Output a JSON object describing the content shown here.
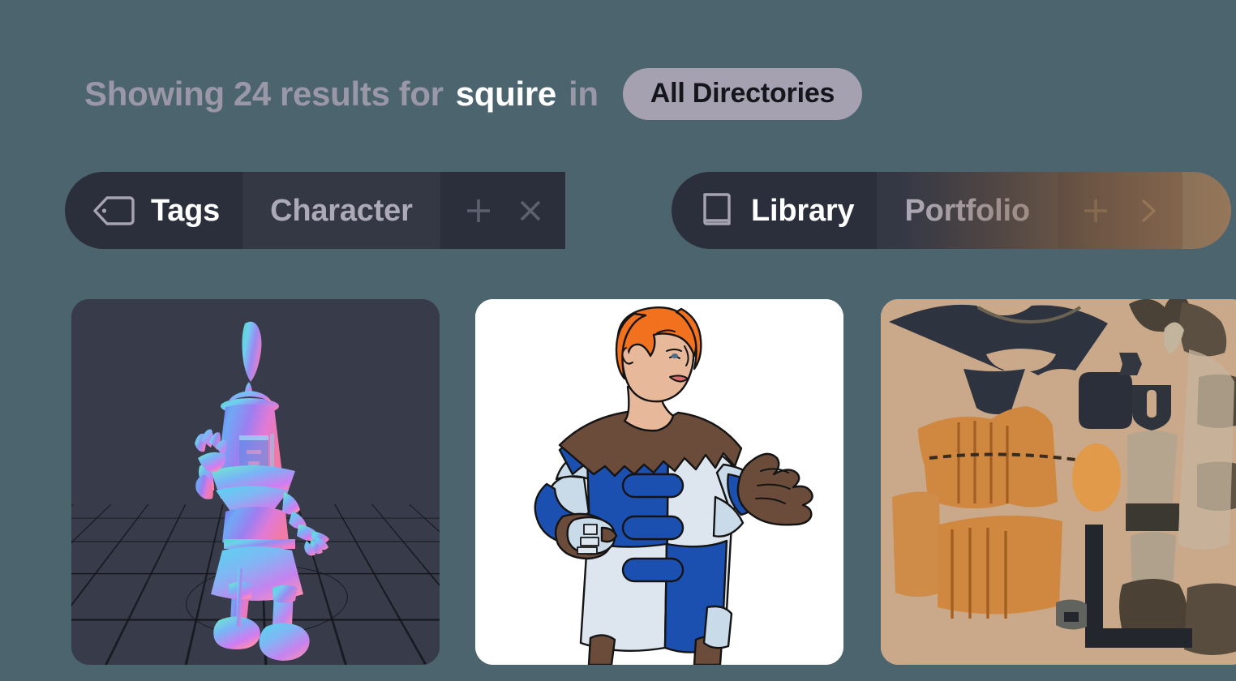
{
  "header": {
    "prefix": "Showing",
    "count": "24",
    "results_word": "results",
    "for_word": "for",
    "query": "squire",
    "in_word": "in",
    "directory_badge": "All Directories",
    "full_text": "Showing 24 results for squire in"
  },
  "filters": [
    {
      "id": "tags",
      "icon": "tag-icon",
      "label": "Tags",
      "value": "Character",
      "add_label": "+",
      "clear_label": "×",
      "actions": [
        "add-tag-button",
        "clear-tag-button"
      ]
    },
    {
      "id": "library",
      "icon": "book-icon",
      "label": "Library",
      "value": "Portfolio",
      "add_label": "+",
      "more_label": "›",
      "actions": [
        "add-library-button",
        "more-library-button"
      ]
    }
  ],
  "results": [
    {
      "index": "1",
      "name": "normal-map-3d-squire-render",
      "kind": "3d-viewport-render",
      "background": "#383b49",
      "alt": "3D squire character rendered with normal-map shading standing on a dark grid floor"
    },
    {
      "index": "2",
      "name": "squire-character-illustration",
      "kind": "illustration",
      "background": "#ffffff",
      "alt": "Illustration of a red-haired squire in blue and white tabard with brown fur mantle and leather glove"
    },
    {
      "index": "3",
      "name": "squire-outfit-texture-atlas",
      "kind": "texture-atlas",
      "background": "#c9a989",
      "alt": "Texture atlas sheet of squire outfit pieces: cape, tunic, belts, boots and gloves"
    }
  ],
  "colors": {
    "page_background": "#4c646e",
    "pill_dark": "#2b2e3b",
    "pill_light": "#343845",
    "muted_text": "#9a97a8",
    "badge_background": "#a5a1b0",
    "badge_text": "#15161c",
    "accent_white": "#ffffff",
    "action_icon": "#5a5e6b"
  }
}
